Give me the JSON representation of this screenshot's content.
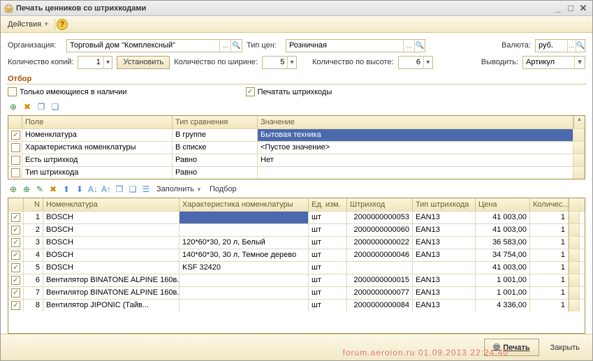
{
  "window": {
    "title": "Печать ценников со штрихкодами"
  },
  "menu": {
    "actions": "Действия"
  },
  "row1": {
    "org_lbl": "Организация:",
    "org_val": "Торговый дом \"Комплексный\"",
    "pricetype_lbl": "Тип цен:",
    "pricetype_val": "Розничная",
    "currency_lbl": "Валюта:",
    "currency_val": "руб."
  },
  "row2": {
    "copies_lbl": "Количество копий:",
    "copies_val": "1",
    "set_btn": "Установить",
    "width_lbl": "Количество по ширине:",
    "width_val": "5",
    "height_lbl": "Количество по высоте:",
    "height_val": "6",
    "output_lbl": "Выводить:",
    "output_val": "Артикул"
  },
  "filter": {
    "title": "Отбор",
    "only_stock": "Только имеющиеся в наличии",
    "print_barcodes": "Печатать штрихкоды"
  },
  "fcols": {
    "c0": "",
    "c1": "Поле",
    "c2": "Тип сравнения",
    "c3": "Значение"
  },
  "frows": [
    {
      "chk": "✓",
      "field": "Номенклатура",
      "cmp": "В группе",
      "val": "Бытовая техника",
      "sel": true
    },
    {
      "chk": "",
      "field": "Характеристика номенклатуры",
      "cmp": "В списке",
      "val": "<Пустое значение>",
      "sel": false
    },
    {
      "chk": "",
      "field": "Есть штрихкод",
      "cmp": "Равно",
      "val": "Нет",
      "sel": false
    },
    {
      "chk": "",
      "field": "Тип штрихкода",
      "cmp": "Равно",
      "val": "",
      "sel": false
    }
  ],
  "act2": {
    "fill": "Заполнить",
    "select": "Подбор"
  },
  "gcols": {
    "chk": "",
    "n": "N",
    "nom": "Номенклатура",
    "char": "Характеристика номенклатуры",
    "ed": "Ед. изм.",
    "bar": "Штрихкод",
    "typ": "Тип штрихкода",
    "price": "Цена",
    "qty": "Количес..."
  },
  "grows": [
    {
      "n": "1",
      "nom": "BOSCH",
      "char": "",
      "ed": "шт",
      "bar": "2000000000053",
      "typ": "EAN13",
      "price": "41 003,00",
      "qty": "1",
      "sel": true
    },
    {
      "n": "2",
      "nom": "BOSCH",
      "char": "",
      "ed": "шт",
      "bar": "2000000000060",
      "typ": "EAN13",
      "price": "41 003,00",
      "qty": "1"
    },
    {
      "n": "3",
      "nom": "BOSCH",
      "char": "120*60*30, 20 л, Белый",
      "ed": "шт",
      "bar": "2000000000022",
      "typ": "EAN13",
      "price": "36 583,00",
      "qty": "1"
    },
    {
      "n": "4",
      "nom": "BOSCH",
      "char": "140*60*30, 30 л, Темное дерево",
      "ed": "шт",
      "bar": "2000000000046",
      "typ": "EAN13",
      "price": "34 754,00",
      "qty": "1"
    },
    {
      "n": "5",
      "nom": "BOSCH",
      "char": "KSF 32420",
      "ed": "шт",
      "bar": "",
      "typ": "",
      "price": "41 003,00",
      "qty": "1"
    },
    {
      "n": "6",
      "nom": "Вентилятор BINATONE ALPINE 160в...",
      "char": "",
      "ed": "шт",
      "bar": "2000000000015",
      "typ": "EAN13",
      "price": "1 001,00",
      "qty": "1"
    },
    {
      "n": "7",
      "nom": "Вентилятор BINATONE ALPINE 160в...",
      "char": "",
      "ed": "шт",
      "bar": "2000000000077",
      "typ": "EAN13",
      "price": "1 001,00",
      "qty": "1"
    },
    {
      "n": "8",
      "nom": "Вентилятор JIPONIC (Тайв...",
      "char": "",
      "ed": "шт",
      "bar": "2000000000084",
      "typ": "EAN13",
      "price": "4 336,00",
      "qty": "1"
    }
  ],
  "footer": {
    "print": "Печать",
    "close": "Закрыть",
    "watermark": "forum.aeroion.ru 01.09.2013 22:24:40"
  }
}
